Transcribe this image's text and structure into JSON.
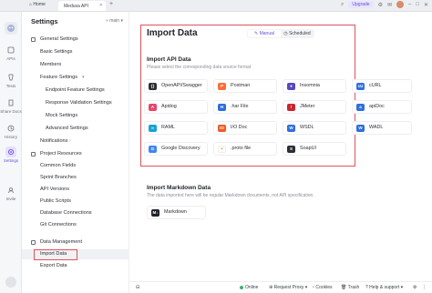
{
  "titlebar": {
    "home_label": "Home",
    "tab_label": "Medusa API",
    "upgrade_label": "Upgrade"
  },
  "rail": {
    "items": [
      {
        "label": "APIs"
      },
      {
        "label": "Tests"
      },
      {
        "label": "Share Docs"
      },
      {
        "label": "History"
      },
      {
        "label": "Settings"
      },
      {
        "label": "Invite"
      }
    ]
  },
  "sidebar": {
    "title": "Settings",
    "branch": "main",
    "general": {
      "label": "General Settings",
      "items": [
        "Basic Settings",
        "Members",
        "Feature Settings"
      ],
      "feature_children": [
        "Endpoint Feature Settings",
        "Response Validation Settings",
        "Mock Settings",
        "Advanced Settings"
      ],
      "notifications": "Notifications"
    },
    "resources": {
      "label": "Project Resources",
      "items": [
        "Common Fields",
        "Sprint Branches",
        "API Versions",
        "Public Scripts",
        "Database Connections",
        "Git Connections"
      ]
    },
    "data": {
      "label": "Data Management",
      "items": [
        "Import Data",
        "Export Data"
      ]
    }
  },
  "main": {
    "title": "Import Data",
    "modes": [
      "Manual",
      "Scheduled"
    ],
    "import_api": {
      "title": "Import API Data",
      "subtitle": "Please select the corresponding data source format",
      "sources": [
        {
          "label": "OpenAPI/Swagger",
          "color": "#2b2f33",
          "glyph": "{}"
        },
        {
          "label": "Postman",
          "color": "#ff6c37",
          "glyph": "P"
        },
        {
          "label": "Insomnia",
          "color": "#5849be",
          "glyph": "●"
        },
        {
          "label": "cURL",
          "color": "#2f6fdc",
          "glyph": "cU"
        },
        {
          "label": "Apidog",
          "color": "#e5476a",
          "glyph": "A"
        },
        {
          "label": ".har File",
          "color": "#2f6fdc",
          "glyph": "H"
        },
        {
          "label": "JMeter",
          "color": "#c8272d",
          "glyph": "/"
        },
        {
          "label": "apiDoc",
          "color": "#2f6fdc",
          "glyph": "a"
        },
        {
          "label": "RAML",
          "color": "#1aa2d4",
          "glyph": "∞"
        },
        {
          "label": "I/O Doc",
          "color": "#f05a28",
          "glyph": "IO"
        },
        {
          "label": "WSDL",
          "color": "#2f6fdc",
          "glyph": "W"
        },
        {
          "label": "WADL",
          "color": "#2f6fdc",
          "glyph": "W"
        },
        {
          "label": "Google Discovery",
          "color": "#4285f4",
          "glyph": "G"
        },
        {
          "label": ".proto file",
          "color": "#ffffff",
          "glyph": "✦"
        },
        {
          "label": "SoapUI",
          "color": "#2b2f33",
          "glyph": "S"
        }
      ]
    },
    "import_md": {
      "title": "Import Markdown Data",
      "subtitle": "The data imported here will be regular Markdown documents, not API specification.",
      "sources": [
        {
          "label": "Markdown",
          "color": "#1f2329",
          "glyph": "M↓"
        }
      ]
    }
  },
  "footer": {
    "online": "Online",
    "proxy": "Request Proxy",
    "cookies": "Cookies",
    "trash": "Trash",
    "help": "Help & support"
  }
}
